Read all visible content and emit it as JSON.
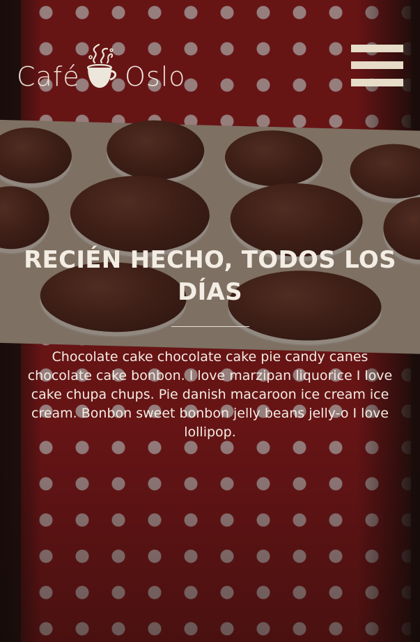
{
  "header": {
    "logo": {
      "word_left": "Café",
      "word_right": "Oslo"
    },
    "menu_icon": "hamburger-menu-icon"
  },
  "hero": {
    "title": "RECIÉN HECHO, TODOS LOS DÍAS",
    "body": "Chocolate cake chocolate cake pie candy canes chocolate cake bonbon. I love marzipan liquorice I love cake chupa chups. Pie danish macaroon ice cream ice cream. Bonbon sweet bonbon jelly beans jelly-o I love lollipop."
  },
  "colors": {
    "text": "#f3ede4",
    "menu_icon": "#e6dcc7",
    "apron_red": "#a01a1e",
    "overlay": "#190c0a"
  }
}
